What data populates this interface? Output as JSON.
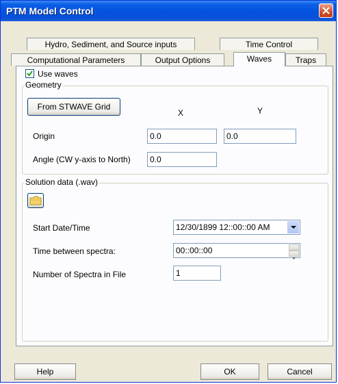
{
  "window": {
    "title": "PTM Model Control"
  },
  "tabs": {
    "row1": [
      {
        "label": "Hydro, Sediment, and Source inputs"
      },
      {
        "label": "Time Control"
      }
    ],
    "row2": [
      {
        "label": "Computational Parameters"
      },
      {
        "label": "Output Options"
      },
      {
        "label": "Waves",
        "active": true
      },
      {
        "label": "Traps"
      }
    ]
  },
  "waves": {
    "use_waves_label": "Use waves",
    "use_waves_checked": true,
    "geometry": {
      "group_label": "Geometry",
      "from_stwave_button": "From STWAVE Grid",
      "x_header": "X",
      "y_header": "Y",
      "origin_label": "Origin",
      "origin_x": "0.0",
      "origin_y": "0.0",
      "angle_label": "Angle (CW y-axis to North)",
      "angle_value": "0.0"
    },
    "solution": {
      "group_label": "Solution data (.wav)",
      "open_folder_icon": "folder-icon",
      "start_label": "Start Date/Time",
      "start_value": "12/30/1899  12::00::00 AM",
      "between_label": "Time between spectra:",
      "between_value": "00::00::00",
      "count_label": "Number of Spectra in File",
      "count_value": "1"
    }
  },
  "footer": {
    "help": "Help",
    "ok": "OK",
    "cancel": "Cancel"
  }
}
